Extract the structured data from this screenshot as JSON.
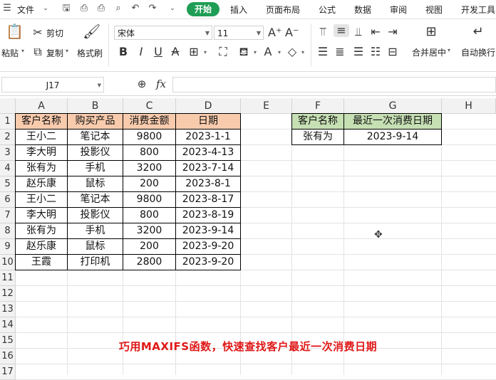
{
  "menubar": {
    "file_label": "文件",
    "tabs": [
      "开始",
      "插入",
      "页面布局",
      "公式",
      "数据",
      "审阅",
      "视图",
      "开发工具"
    ]
  },
  "ribbon": {
    "paste_label": "粘贴",
    "cut_label": "剪切",
    "copy_label": "复制",
    "format_painter_label": "格式刷",
    "font_name": "宋体",
    "font_size": "11",
    "merge_label": "合并居中",
    "wrap_label": "自动换行"
  },
  "formula_bar": {
    "cell_ref": "J17",
    "fx_label": "fx",
    "formula": ""
  },
  "sheet": {
    "columns": [
      "A",
      "B",
      "C",
      "D",
      "E",
      "F",
      "G",
      "H"
    ],
    "rows": [
      "1",
      "2",
      "3",
      "4",
      "5",
      "6",
      "7",
      "8",
      "9",
      "10",
      "11",
      "12",
      "13",
      "14",
      "15",
      "16",
      "17"
    ],
    "table1_headers": [
      "客户名称",
      "购买产品",
      "消费金额",
      "日期"
    ],
    "table1_rows": [
      [
        "王小二",
        "笔记本",
        "9800",
        "2023-1-1"
      ],
      [
        "李大明",
        "投影仪",
        "800",
        "2023-4-13"
      ],
      [
        "张有为",
        "手机",
        "3200",
        "2023-7-14"
      ],
      [
        "赵乐康",
        "鼠标",
        "200",
        "2023-8-1"
      ],
      [
        "王小二",
        "笔记本",
        "9800",
        "2023-8-17"
      ],
      [
        "李大明",
        "投影仪",
        "800",
        "2023-8-19"
      ],
      [
        "张有为",
        "手机",
        "3200",
        "2023-9-14"
      ],
      [
        "赵乐康",
        "鼠标",
        "200",
        "2023-9-20"
      ],
      [
        "王霞",
        "打印机",
        "2800",
        "2023-9-20"
      ]
    ],
    "table2_headers": [
      "客户名称",
      "最近一次消费日期"
    ],
    "table2_rows": [
      [
        "张有为",
        "2023-9-14"
      ]
    ]
  },
  "caption": "巧用MAXIFS函数，快速查找客户最近一次消费日期",
  "colors": {
    "accent_green": "#1f9d55",
    "header_orange": "#f8cbad",
    "header_green": "#c6e0b4",
    "caption_red": "#e01818"
  }
}
